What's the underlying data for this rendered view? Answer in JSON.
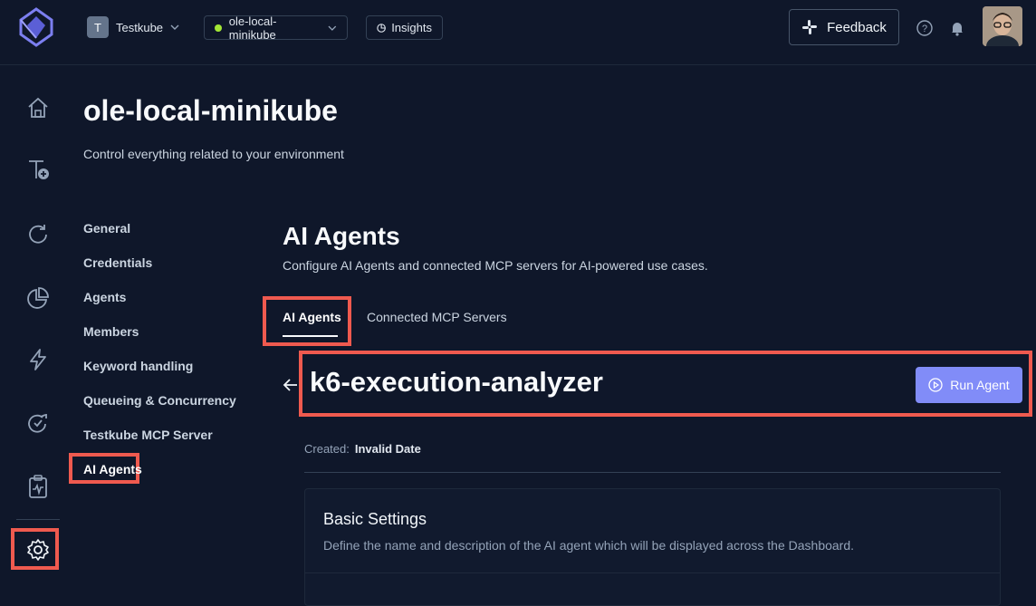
{
  "topbar": {
    "org": {
      "initial": "T",
      "name": "Testkube"
    },
    "environment": {
      "name": "ole-local-minikube",
      "status_color": "#a3e635"
    },
    "insights_label": "Insights",
    "feedback_label": "Feedback"
  },
  "sidenav": {
    "items": [
      "home-icon",
      "add-test-icon",
      "refresh-icon",
      "pie-chart-icon",
      "bolt-icon",
      "refresh-check-icon",
      "clipboard-pulse-icon",
      "settings-icon"
    ],
    "active": "settings-icon"
  },
  "page": {
    "title": "ole-local-minikube",
    "subtitle": "Control everything related to your environment"
  },
  "settings_menu": {
    "items": [
      {
        "label": "General"
      },
      {
        "label": "Credentials"
      },
      {
        "label": "Agents"
      },
      {
        "label": "Members"
      },
      {
        "label": "Keyword handling"
      },
      {
        "label": "Queueing & Concurrency"
      },
      {
        "label": "Testkube MCP Server"
      },
      {
        "label": "AI Agents"
      }
    ],
    "active_index": 7
  },
  "section": {
    "title": "AI Agents",
    "subtitle": "Configure AI Agents and connected MCP servers for AI-powered use cases.",
    "tabs": [
      {
        "label": "AI Agents"
      },
      {
        "label": "Connected MCP Servers"
      }
    ],
    "active_tab": 0
  },
  "agent": {
    "name": "k6-execution-analyzer",
    "run_label": "Run Agent",
    "created_label": "Created:",
    "created_value": "Invalid Date"
  },
  "basic_settings": {
    "title": "Basic Settings",
    "description": "Define the name and description of the AI agent which will be displayed across the Dashboard."
  },
  "colors": {
    "accent": "#818cf8",
    "highlight": "#ef5a4f",
    "background": "#0f172a"
  }
}
